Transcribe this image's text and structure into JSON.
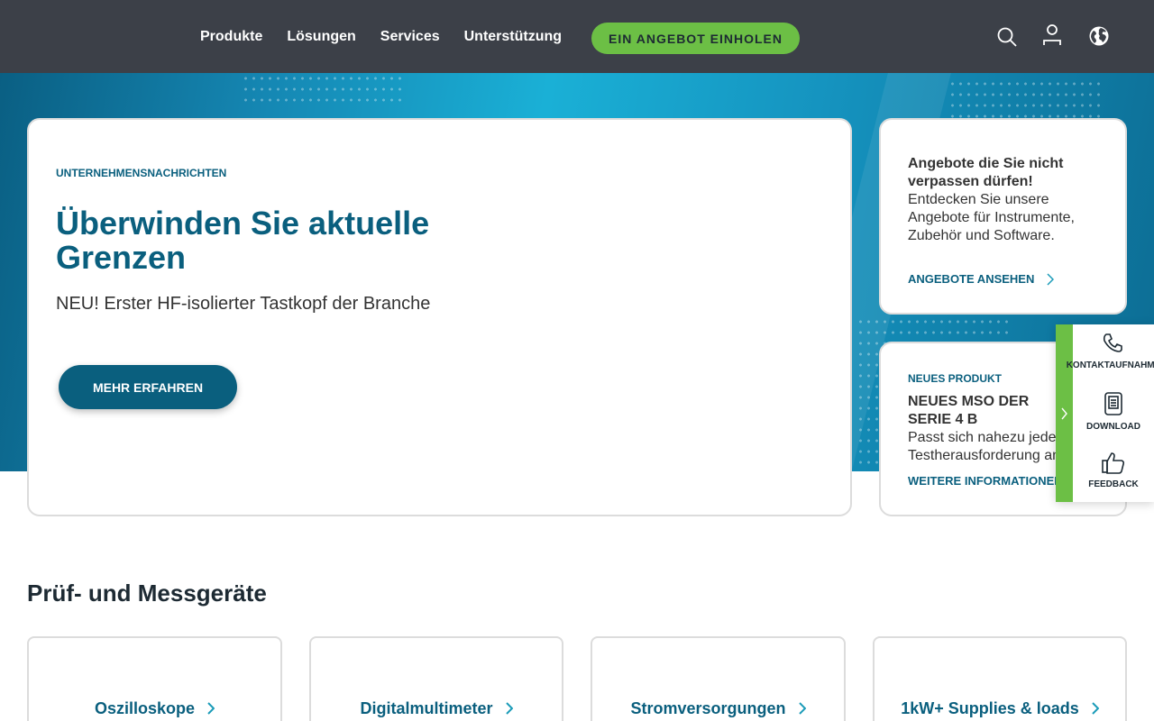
{
  "header": {
    "nav": [
      "Produkte",
      "Lösungen",
      "Services",
      "Unterstützung"
    ],
    "cta_label": "EIN ANGEBOT EINHOLEN",
    "icons": [
      "search-icon",
      "user-icon",
      "globe-icon"
    ]
  },
  "hero": {
    "eyebrow": "UNTERNEHMENSNACHRICHTEN",
    "title": "Überwinden Sie aktuelle Grenzen",
    "subtitle": "NEU! Erster HF-isolierter Tastkopf der Branche",
    "button_label": "MEHR ERFAHREN"
  },
  "side_cards": [
    {
      "title": "Angebote die Sie nicht verpassen dürfen!",
      "text": "Entdecken Sie unsere Angebote für Instrumente, Zubehör und Software.",
      "link": "ANGEBOTE ANSEHEN"
    },
    {
      "eyebrow": "NEUES PRODUKT",
      "title": "NEUES MSO DER SERIE 4 B",
      "text": "Passt sich nahezu jeder Testherausforderung an",
      "link": "WEITERE INFORMATIONEN"
    }
  ],
  "float_panel": {
    "items": [
      {
        "label": "KONTAKTAUFNAHME",
        "icon": "phone-icon"
      },
      {
        "label": "DOWNLOAD",
        "icon": "download-icon"
      },
      {
        "label": "FEEDBACK",
        "icon": "thumbs-up-icon"
      }
    ]
  },
  "section": {
    "title": "Prüf- und Messgeräte",
    "categories": [
      "Oszilloskope",
      "Digitalmultimeter",
      "Stromversorgungen",
      "1kW+ Supplies & loads"
    ]
  },
  "colors": {
    "header_bg": "#3c4048",
    "accent_green": "#6cbf45",
    "brand_blue": "#0a5f7e",
    "link_teal": "#1a9bb8"
  }
}
